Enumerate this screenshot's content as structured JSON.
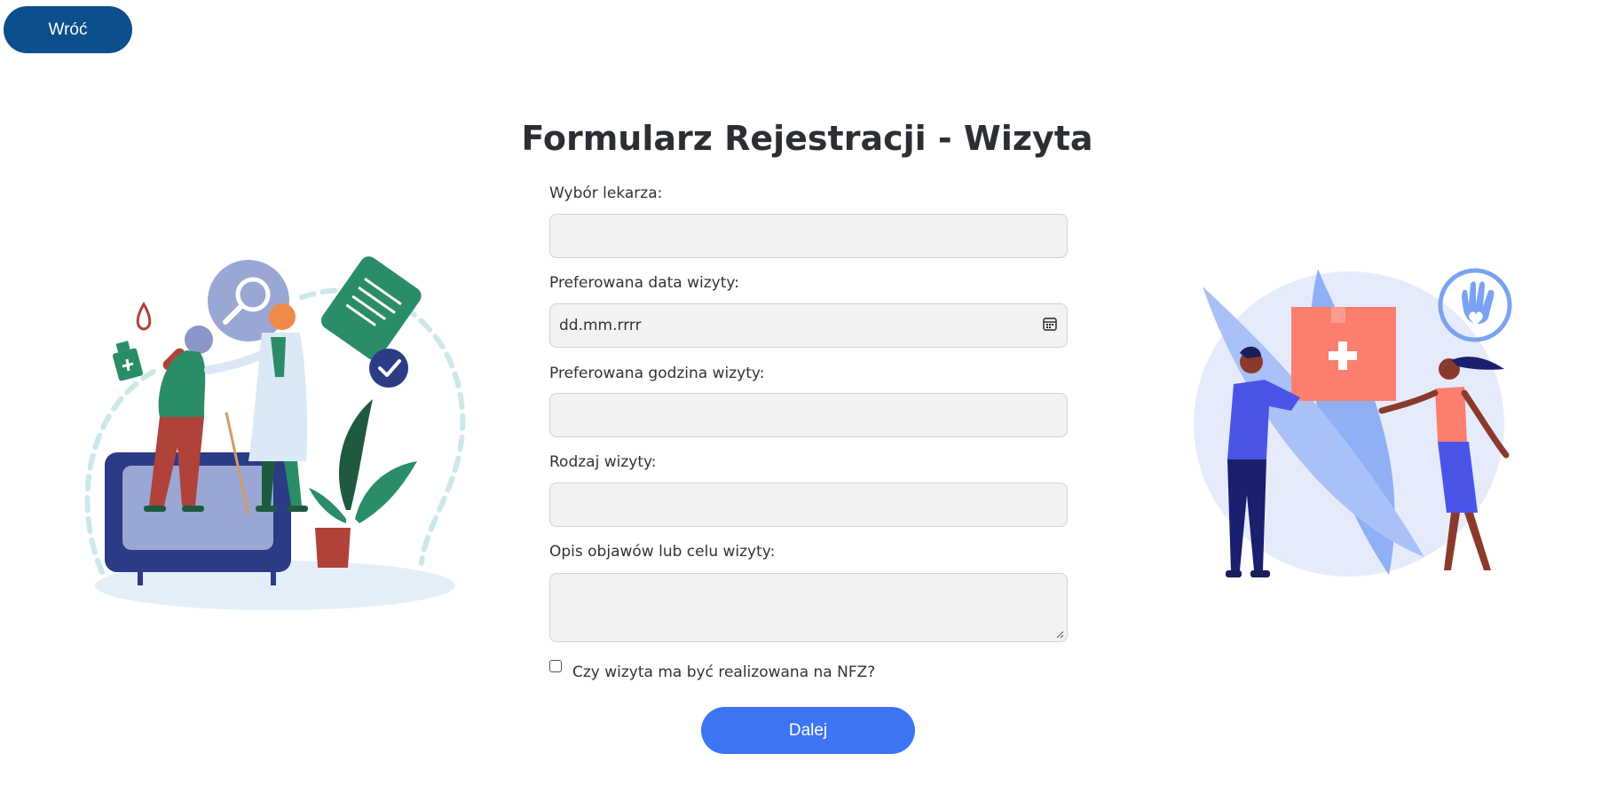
{
  "nav": {
    "back_label": "Wróć"
  },
  "form": {
    "title": "Formularz Rejestracji - Wizyta",
    "doctor_label": "Wybór lekarza:",
    "doctor_value": "",
    "date_label": "Preferowana data wizyty:",
    "date_placeholder": "dd.mm.rrrr",
    "time_label": "Preferowana godzina wizyty:",
    "time_value": "",
    "type_label": "Rodzaj wizyty:",
    "type_value": "",
    "description_label": "Opis objawów lub celu wizyty:",
    "description_value": "",
    "nfz_label": "Czy wizyta ma być realizowana na NFZ?",
    "nfz_checked": false,
    "next_label": "Dalej"
  },
  "colors": {
    "back_button": "#0b4f8c",
    "next_button": "#3d74f3",
    "field_background": "#f2f2f2"
  },
  "icons": {
    "date_picker": "calendar-icon",
    "left_illustration": "elderly-patient-with-doctor-illustration",
    "right_illustration": "medical-aid-box-handover-illustration"
  }
}
